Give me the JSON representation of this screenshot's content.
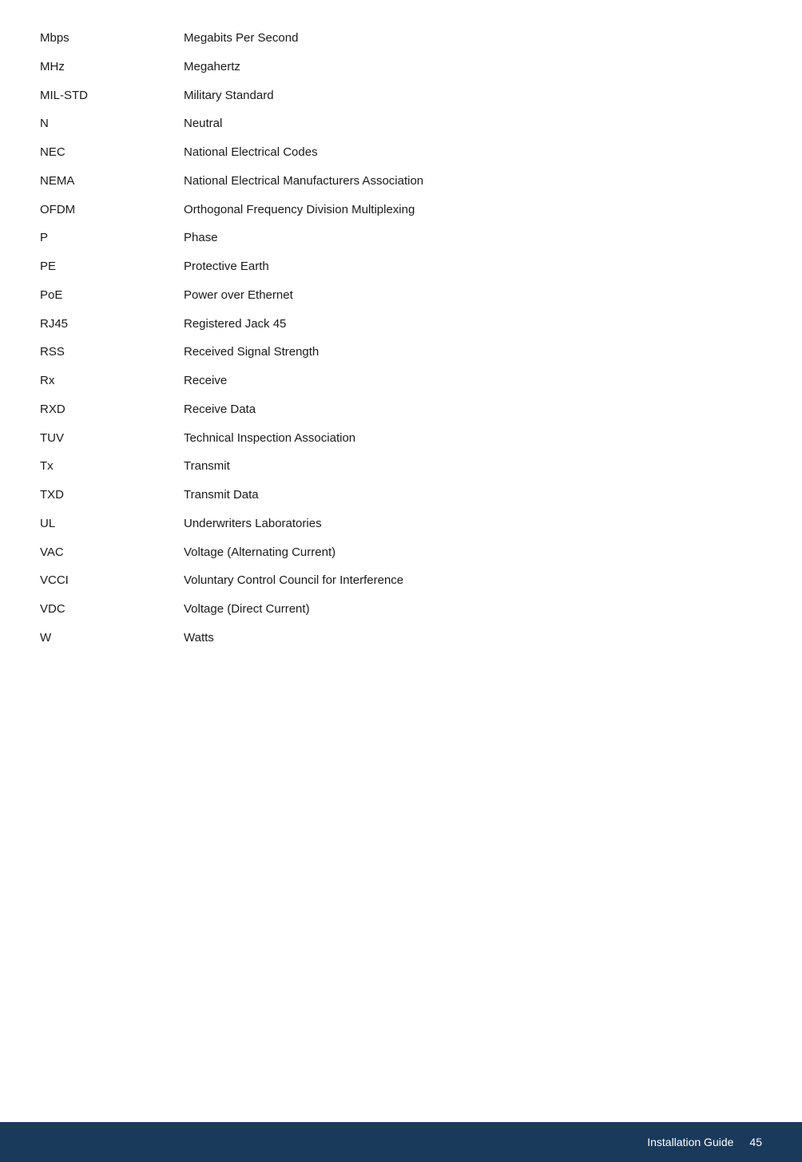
{
  "glossary": {
    "entries": [
      {
        "abbr": "Mbps",
        "definition": "Megabits Per Second"
      },
      {
        "abbr": "MHz",
        "definition": "Megahertz"
      },
      {
        "abbr": "MIL-STD",
        "definition": "Military Standard"
      },
      {
        "abbr": "N",
        "definition": "Neutral"
      },
      {
        "abbr": "NEC",
        "definition": "National Electrical Codes"
      },
      {
        "abbr": "NEMA",
        "definition": "National Electrical Manufacturers Association"
      },
      {
        "abbr": "OFDM",
        "definition": "Orthogonal Frequency Division Multiplexing"
      },
      {
        "abbr": "P",
        "definition": "Phase"
      },
      {
        "abbr": "PE",
        "definition": "Protective Earth"
      },
      {
        "abbr": "PoE",
        "definition": "Power over Ethernet"
      },
      {
        "abbr": "RJ45",
        "definition": "Registered Jack 45"
      },
      {
        "abbr": "RSS",
        "definition": "Received Signal Strength"
      },
      {
        "abbr": "Rx",
        "definition": "Receive"
      },
      {
        "abbr": "RXD",
        "definition": "Receive Data"
      },
      {
        "abbr": "TUV",
        "definition": "Technical Inspection Association"
      },
      {
        "abbr": "Tx",
        "definition": "Transmit"
      },
      {
        "abbr": "TXD",
        "definition": "Transmit Data"
      },
      {
        "abbr": "UL",
        "definition": "Underwriters Laboratories"
      },
      {
        "abbr": "VAC",
        "definition": "Voltage (Alternating Current)"
      },
      {
        "abbr": "VCCI",
        "definition": "Voluntary Control Council for Interference"
      },
      {
        "abbr": "VDC",
        "definition": "Voltage (Direct Current)"
      },
      {
        "abbr": "W",
        "definition": "Watts"
      }
    ]
  },
  "footer": {
    "label": "Installation Guide",
    "page": "45"
  }
}
